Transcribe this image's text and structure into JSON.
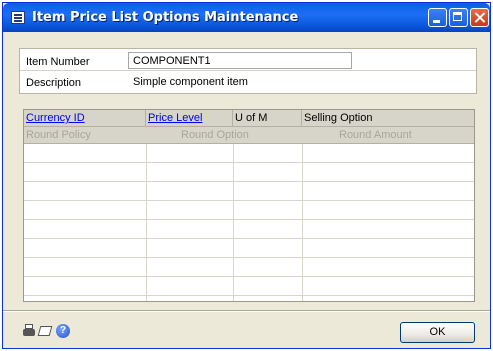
{
  "window": {
    "title": "Item Price List Options Maintenance"
  },
  "header": {
    "item_number_label": "Item Number",
    "item_number_value": "COMPONENT1",
    "description_label": "Description",
    "description_value": "Simple component item"
  },
  "grid": {
    "row1_headers": [
      "Currency ID",
      "Price Level",
      "U of M",
      "Selling Option"
    ],
    "row2_headers": [
      "Round Policy",
      "Round Option",
      "Round Amount"
    ],
    "expand_up_icon": "double-chevron-up-icon",
    "expand_down_icon": "double-chevron-down-icon"
  },
  "footer": {
    "icons": [
      "printer-icon",
      "note-icon",
      "help-icon"
    ],
    "help_glyph": "?",
    "ok_label": "OK"
  }
}
